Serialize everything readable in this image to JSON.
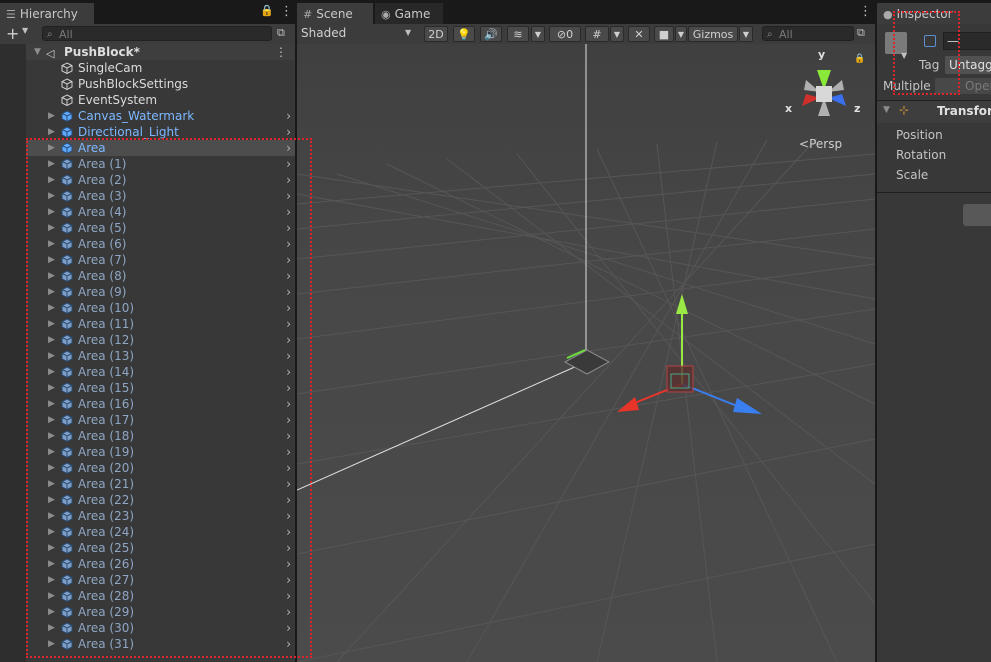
{
  "hierarchy": {
    "title": "Hierarchy",
    "search_placeholder": "All",
    "scene_name": "PushBlock*",
    "items": [
      {
        "label": "SingleCam",
        "style": "white",
        "arrow": false,
        "prefab": false
      },
      {
        "label": "PushBlockSettings",
        "style": "white",
        "arrow": false,
        "prefab": false
      },
      {
        "label": "EventSystem",
        "style": "white",
        "arrow": false,
        "prefab": false
      },
      {
        "label": "Canvas_Watermark",
        "style": "blue",
        "arrow": true,
        "prefab": true
      },
      {
        "label": "Directional_Light",
        "style": "blue",
        "arrow": true,
        "prefab": true
      },
      {
        "label": "Area",
        "style": "blue",
        "arrow": true,
        "prefab": true,
        "selected": true
      },
      {
        "label": "Area (1)",
        "style": "grayblue",
        "arrow": true,
        "prefab": true
      },
      {
        "label": "Area (2)",
        "style": "grayblue",
        "arrow": true,
        "prefab": true
      },
      {
        "label": "Area (3)",
        "style": "grayblue",
        "arrow": true,
        "prefab": true
      },
      {
        "label": "Area (4)",
        "style": "grayblue",
        "arrow": true,
        "prefab": true
      },
      {
        "label": "Area (5)",
        "style": "grayblue",
        "arrow": true,
        "prefab": true
      },
      {
        "label": "Area (6)",
        "style": "grayblue",
        "arrow": true,
        "prefab": true
      },
      {
        "label": "Area (7)",
        "style": "grayblue",
        "arrow": true,
        "prefab": true
      },
      {
        "label": "Area (8)",
        "style": "grayblue",
        "arrow": true,
        "prefab": true
      },
      {
        "label": "Area (9)",
        "style": "grayblue",
        "arrow": true,
        "prefab": true
      },
      {
        "label": "Area (10)",
        "style": "grayblue",
        "arrow": true,
        "prefab": true
      },
      {
        "label": "Area (11)",
        "style": "grayblue",
        "arrow": true,
        "prefab": true
      },
      {
        "label": "Area (12)",
        "style": "grayblue",
        "arrow": true,
        "prefab": true
      },
      {
        "label": "Area (13)",
        "style": "grayblue",
        "arrow": true,
        "prefab": true
      },
      {
        "label": "Area (14)",
        "style": "grayblue",
        "arrow": true,
        "prefab": true
      },
      {
        "label": "Area (15)",
        "style": "grayblue",
        "arrow": true,
        "prefab": true
      },
      {
        "label": "Area (16)",
        "style": "grayblue",
        "arrow": true,
        "prefab": true
      },
      {
        "label": "Area (17)",
        "style": "grayblue",
        "arrow": true,
        "prefab": true
      },
      {
        "label": "Area (18)",
        "style": "grayblue",
        "arrow": true,
        "prefab": true
      },
      {
        "label": "Area (19)",
        "style": "grayblue",
        "arrow": true,
        "prefab": true
      },
      {
        "label": "Area (20)",
        "style": "grayblue",
        "arrow": true,
        "prefab": true
      },
      {
        "label": "Area (21)",
        "style": "grayblue",
        "arrow": true,
        "prefab": true
      },
      {
        "label": "Area (22)",
        "style": "grayblue",
        "arrow": true,
        "prefab": true
      },
      {
        "label": "Area (23)",
        "style": "grayblue",
        "arrow": true,
        "prefab": true
      },
      {
        "label": "Area (24)",
        "style": "grayblue",
        "arrow": true,
        "prefab": true
      },
      {
        "label": "Area (25)",
        "style": "grayblue",
        "arrow": true,
        "prefab": true
      },
      {
        "label": "Area (26)",
        "style": "grayblue",
        "arrow": true,
        "prefab": true
      },
      {
        "label": "Area (27)",
        "style": "grayblue",
        "arrow": true,
        "prefab": true
      },
      {
        "label": "Area (28)",
        "style": "grayblue",
        "arrow": true,
        "prefab": true
      },
      {
        "label": "Area (29)",
        "style": "grayblue",
        "arrow": true,
        "prefab": true
      },
      {
        "label": "Area (30)",
        "style": "grayblue",
        "arrow": true,
        "prefab": true
      },
      {
        "label": "Area (31)",
        "style": "grayblue",
        "arrow": true,
        "prefab": true
      }
    ]
  },
  "scene": {
    "tabs": [
      {
        "label": "Scene",
        "icon": "hash-icon"
      },
      {
        "label": "Game",
        "icon": "gamepad-icon"
      }
    ],
    "shading_mode": "Shaded",
    "btn_2d": "2D",
    "hidden_count": "0",
    "gizmos_label": "Gizmos",
    "search_placeholder": "All",
    "persp_label": "Persp",
    "axis_labels": {
      "x": "x",
      "y": "y",
      "z": "z"
    }
  },
  "inspector": {
    "title": "Inspector",
    "name_value": "—",
    "tag_label": "Tag",
    "tag_value": "Untagg",
    "multiple_label": "Multiple",
    "open_label": "Open",
    "component_title": "Transform",
    "fields": [
      "Position",
      "Rotation",
      "Scale"
    ]
  },
  "colors": {
    "annotation_red": "#e0242a",
    "axis_x": "#e8352a",
    "axis_y": "#9ae845",
    "axis_z": "#3a7ff0",
    "prefab_blue": "#7cb8ff"
  }
}
